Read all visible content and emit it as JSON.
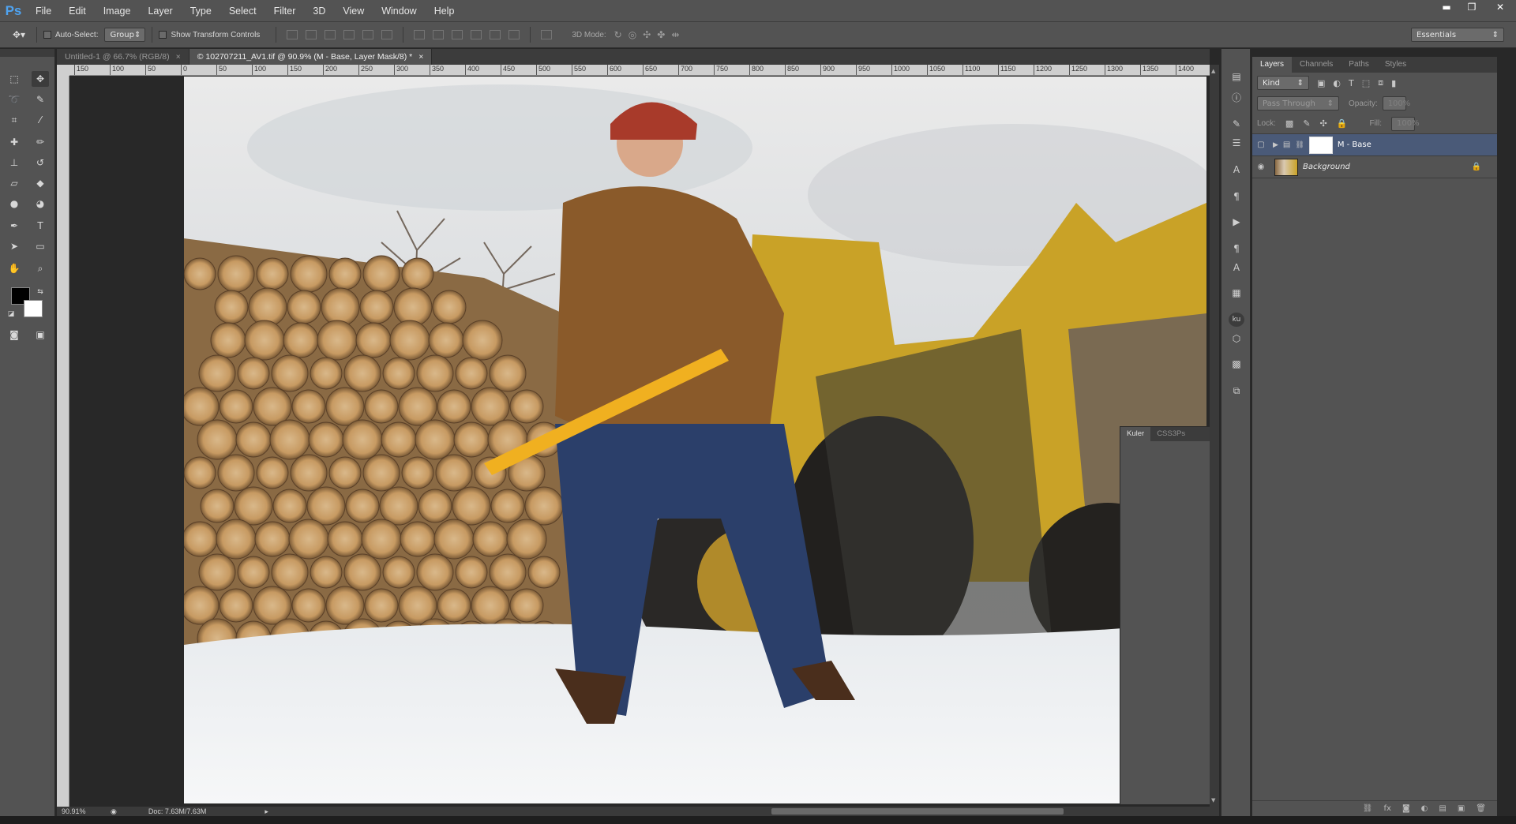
{
  "app": {
    "logo": "Ps"
  },
  "menu": [
    "File",
    "Edit",
    "Image",
    "Layer",
    "Type",
    "Select",
    "Filter",
    "3D",
    "View",
    "Window",
    "Help"
  ],
  "window_controls": {
    "minimize": "▬",
    "restore": "❐",
    "close": "✕"
  },
  "options": {
    "auto_select_label": "Auto-Select:",
    "auto_select_value": "Group",
    "show_transform_label": "Show Transform Controls",
    "mode_3d_label": "3D Mode:",
    "workspace": "Essentials"
  },
  "doc_tabs": [
    {
      "label": "Untitled-1 @ 66.7% (RGB/8)",
      "close": "×"
    },
    {
      "label": "© 102707211_AV1.tif @ 90.9% (M - Base, Layer Mask/8) *",
      "close": "×"
    }
  ],
  "ruler_ticks": [
    "150",
    "100",
    "50",
    "0",
    "50",
    "100",
    "150",
    "200",
    "250",
    "300",
    "350",
    "400",
    "450",
    "500",
    "550",
    "600",
    "650",
    "700",
    "750",
    "800",
    "850",
    "900",
    "950",
    "1000",
    "1050",
    "1100",
    "1150",
    "1200",
    "1250",
    "1300",
    "1350",
    "1400"
  ],
  "kuler": {
    "tabs": [
      "Kuler",
      "CSS3Ps"
    ]
  },
  "status": {
    "zoom": "90.91%",
    "doc": "Doc: 7.63M/7.63M"
  },
  "layers_panel": {
    "tabs": [
      "Layers",
      "Channels",
      "Paths",
      "Styles"
    ],
    "filter_kind": "Kind",
    "blend_mode": "Pass Through",
    "opacity_label": "Opacity:",
    "opacity_value": "100%",
    "lock_label": "Lock:",
    "fill_label": "Fill:",
    "fill_value": "100%",
    "layers": [
      {
        "name": "M - Base",
        "type": "group",
        "selected": true
      },
      {
        "name": "Background",
        "type": "image",
        "selected": false,
        "locked": true
      }
    ],
    "footer_icons": [
      "link-icon",
      "fx-icon",
      "mask-icon",
      "adjustment-icon",
      "folder-icon",
      "new-layer-icon",
      "trash-icon"
    ]
  },
  "colors": {
    "accent": "#4fa3f0",
    "panel": "#535353",
    "dark": "#282828",
    "selected_layer": "#4a5a78"
  }
}
